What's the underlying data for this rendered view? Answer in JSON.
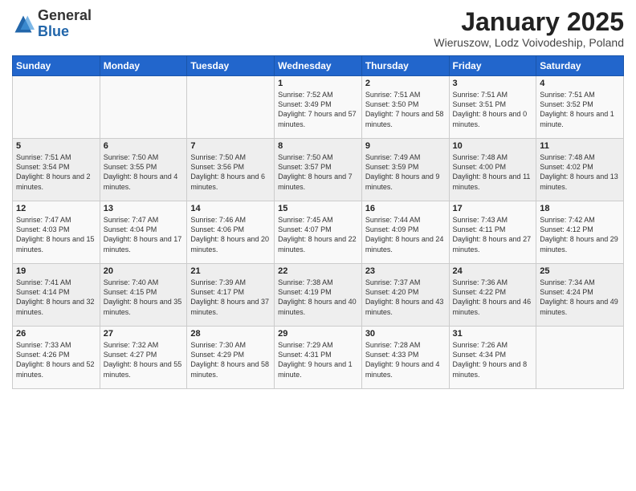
{
  "logo": {
    "general": "General",
    "blue": "Blue"
  },
  "title": "January 2025",
  "subtitle": "Wieruszow, Lodz Voivodeship, Poland",
  "headers": [
    "Sunday",
    "Monday",
    "Tuesday",
    "Wednesday",
    "Thursday",
    "Friday",
    "Saturday"
  ],
  "weeks": [
    [
      {
        "day": "",
        "info": ""
      },
      {
        "day": "",
        "info": ""
      },
      {
        "day": "",
        "info": ""
      },
      {
        "day": "1",
        "info": "Sunrise: 7:52 AM\nSunset: 3:49 PM\nDaylight: 7 hours and 57 minutes."
      },
      {
        "day": "2",
        "info": "Sunrise: 7:51 AM\nSunset: 3:50 PM\nDaylight: 7 hours and 58 minutes."
      },
      {
        "day": "3",
        "info": "Sunrise: 7:51 AM\nSunset: 3:51 PM\nDaylight: 8 hours and 0 minutes."
      },
      {
        "day": "4",
        "info": "Sunrise: 7:51 AM\nSunset: 3:52 PM\nDaylight: 8 hours and 1 minute."
      }
    ],
    [
      {
        "day": "5",
        "info": "Sunrise: 7:51 AM\nSunset: 3:54 PM\nDaylight: 8 hours and 2 minutes."
      },
      {
        "day": "6",
        "info": "Sunrise: 7:50 AM\nSunset: 3:55 PM\nDaylight: 8 hours and 4 minutes."
      },
      {
        "day": "7",
        "info": "Sunrise: 7:50 AM\nSunset: 3:56 PM\nDaylight: 8 hours and 6 minutes."
      },
      {
        "day": "8",
        "info": "Sunrise: 7:50 AM\nSunset: 3:57 PM\nDaylight: 8 hours and 7 minutes."
      },
      {
        "day": "9",
        "info": "Sunrise: 7:49 AM\nSunset: 3:59 PM\nDaylight: 8 hours and 9 minutes."
      },
      {
        "day": "10",
        "info": "Sunrise: 7:48 AM\nSunset: 4:00 PM\nDaylight: 8 hours and 11 minutes."
      },
      {
        "day": "11",
        "info": "Sunrise: 7:48 AM\nSunset: 4:02 PM\nDaylight: 8 hours and 13 minutes."
      }
    ],
    [
      {
        "day": "12",
        "info": "Sunrise: 7:47 AM\nSunset: 4:03 PM\nDaylight: 8 hours and 15 minutes."
      },
      {
        "day": "13",
        "info": "Sunrise: 7:47 AM\nSunset: 4:04 PM\nDaylight: 8 hours and 17 minutes."
      },
      {
        "day": "14",
        "info": "Sunrise: 7:46 AM\nSunset: 4:06 PM\nDaylight: 8 hours and 20 minutes."
      },
      {
        "day": "15",
        "info": "Sunrise: 7:45 AM\nSunset: 4:07 PM\nDaylight: 8 hours and 22 minutes."
      },
      {
        "day": "16",
        "info": "Sunrise: 7:44 AM\nSunset: 4:09 PM\nDaylight: 8 hours and 24 minutes."
      },
      {
        "day": "17",
        "info": "Sunrise: 7:43 AM\nSunset: 4:11 PM\nDaylight: 8 hours and 27 minutes."
      },
      {
        "day": "18",
        "info": "Sunrise: 7:42 AM\nSunset: 4:12 PM\nDaylight: 8 hours and 29 minutes."
      }
    ],
    [
      {
        "day": "19",
        "info": "Sunrise: 7:41 AM\nSunset: 4:14 PM\nDaylight: 8 hours and 32 minutes."
      },
      {
        "day": "20",
        "info": "Sunrise: 7:40 AM\nSunset: 4:15 PM\nDaylight: 8 hours and 35 minutes."
      },
      {
        "day": "21",
        "info": "Sunrise: 7:39 AM\nSunset: 4:17 PM\nDaylight: 8 hours and 37 minutes."
      },
      {
        "day": "22",
        "info": "Sunrise: 7:38 AM\nSunset: 4:19 PM\nDaylight: 8 hours and 40 minutes."
      },
      {
        "day": "23",
        "info": "Sunrise: 7:37 AM\nSunset: 4:20 PM\nDaylight: 8 hours and 43 minutes."
      },
      {
        "day": "24",
        "info": "Sunrise: 7:36 AM\nSunset: 4:22 PM\nDaylight: 8 hours and 46 minutes."
      },
      {
        "day": "25",
        "info": "Sunrise: 7:34 AM\nSunset: 4:24 PM\nDaylight: 8 hours and 49 minutes."
      }
    ],
    [
      {
        "day": "26",
        "info": "Sunrise: 7:33 AM\nSunset: 4:26 PM\nDaylight: 8 hours and 52 minutes."
      },
      {
        "day": "27",
        "info": "Sunrise: 7:32 AM\nSunset: 4:27 PM\nDaylight: 8 hours and 55 minutes."
      },
      {
        "day": "28",
        "info": "Sunrise: 7:30 AM\nSunset: 4:29 PM\nDaylight: 8 hours and 58 minutes."
      },
      {
        "day": "29",
        "info": "Sunrise: 7:29 AM\nSunset: 4:31 PM\nDaylight: 9 hours and 1 minute."
      },
      {
        "day": "30",
        "info": "Sunrise: 7:28 AM\nSunset: 4:33 PM\nDaylight: 9 hours and 4 minutes."
      },
      {
        "day": "31",
        "info": "Sunrise: 7:26 AM\nSunset: 4:34 PM\nDaylight: 9 hours and 8 minutes."
      },
      {
        "day": "",
        "info": ""
      }
    ]
  ]
}
